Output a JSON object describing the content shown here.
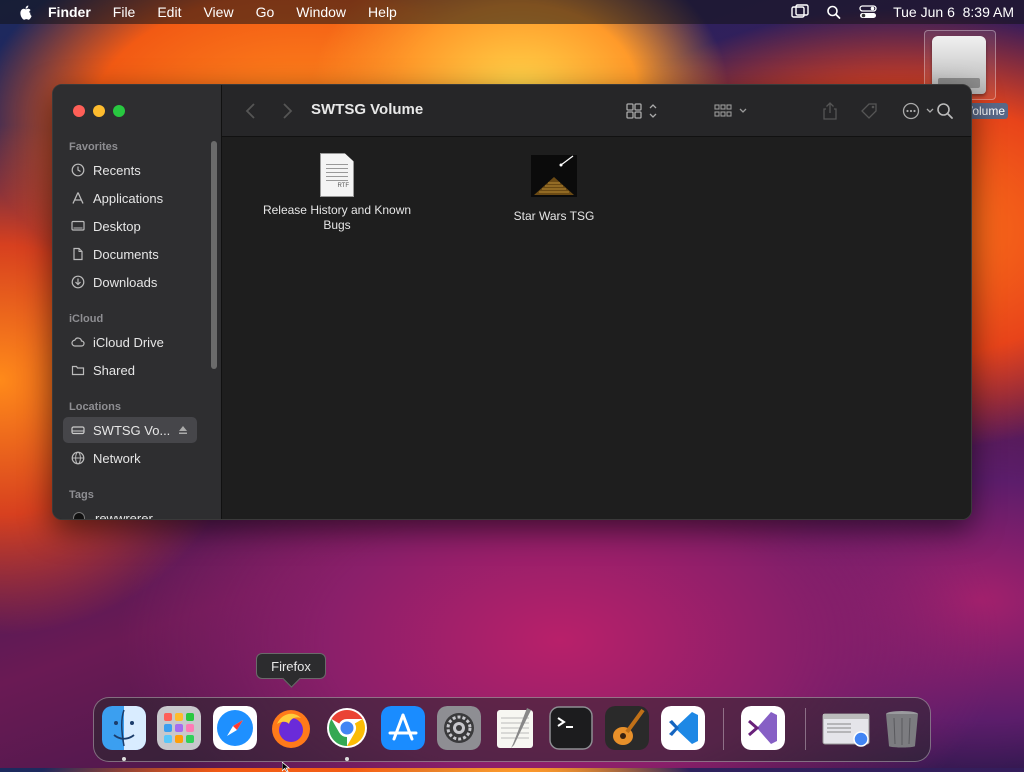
{
  "menubar": {
    "app": "Finder",
    "menus": [
      "File",
      "Edit",
      "View",
      "Go",
      "Window",
      "Help"
    ],
    "datetime": "Tue Jun 6  8:39 AM"
  },
  "desktop": {
    "volume_label": "SWTSG Volume"
  },
  "window": {
    "title": "SWTSG Volume",
    "sidebar": {
      "favorites_title": "Favorites",
      "favorites": [
        {
          "label": "Recents",
          "icon": "clock-icon"
        },
        {
          "label": "Applications",
          "icon": "applications-icon"
        },
        {
          "label": "Desktop",
          "icon": "desktop-icon"
        },
        {
          "label": "Documents",
          "icon": "document-icon"
        },
        {
          "label": "Downloads",
          "icon": "download-icon"
        }
      ],
      "icloud_title": "iCloud",
      "icloud": [
        {
          "label": "iCloud Drive",
          "icon": "cloud-icon"
        },
        {
          "label": "Shared",
          "icon": "shared-folder-icon"
        }
      ],
      "locations_title": "Locations",
      "locations": [
        {
          "label": "SWTSG Vo...",
          "icon": "drive-icon",
          "selected": true
        },
        {
          "label": "Network",
          "icon": "network-icon"
        }
      ],
      "tags_title": "Tags",
      "tags": [
        {
          "label": "rewwrerer"
        }
      ]
    },
    "files": [
      {
        "name": "Release History and Known Bugs",
        "kind": "rtf-document",
        "badge": "RTF"
      },
      {
        "name": "Star Wars TSG",
        "kind": "application"
      }
    ]
  },
  "tooltip": {
    "text": "Firefox"
  },
  "dock": {
    "apps": [
      "Finder",
      "Launchpad",
      "Safari",
      "Firefox",
      "Google Chrome",
      "App Store",
      "System Settings",
      "TextEdit",
      "Terminal",
      "GarageBand",
      "Visual Studio Code",
      "Visual Studio",
      "Chrome Apps",
      "Trash"
    ]
  },
  "colors": {
    "window_bg": "#1e1e1e",
    "sidebar_bg": "#2e2e30",
    "selection": "#46464a"
  }
}
